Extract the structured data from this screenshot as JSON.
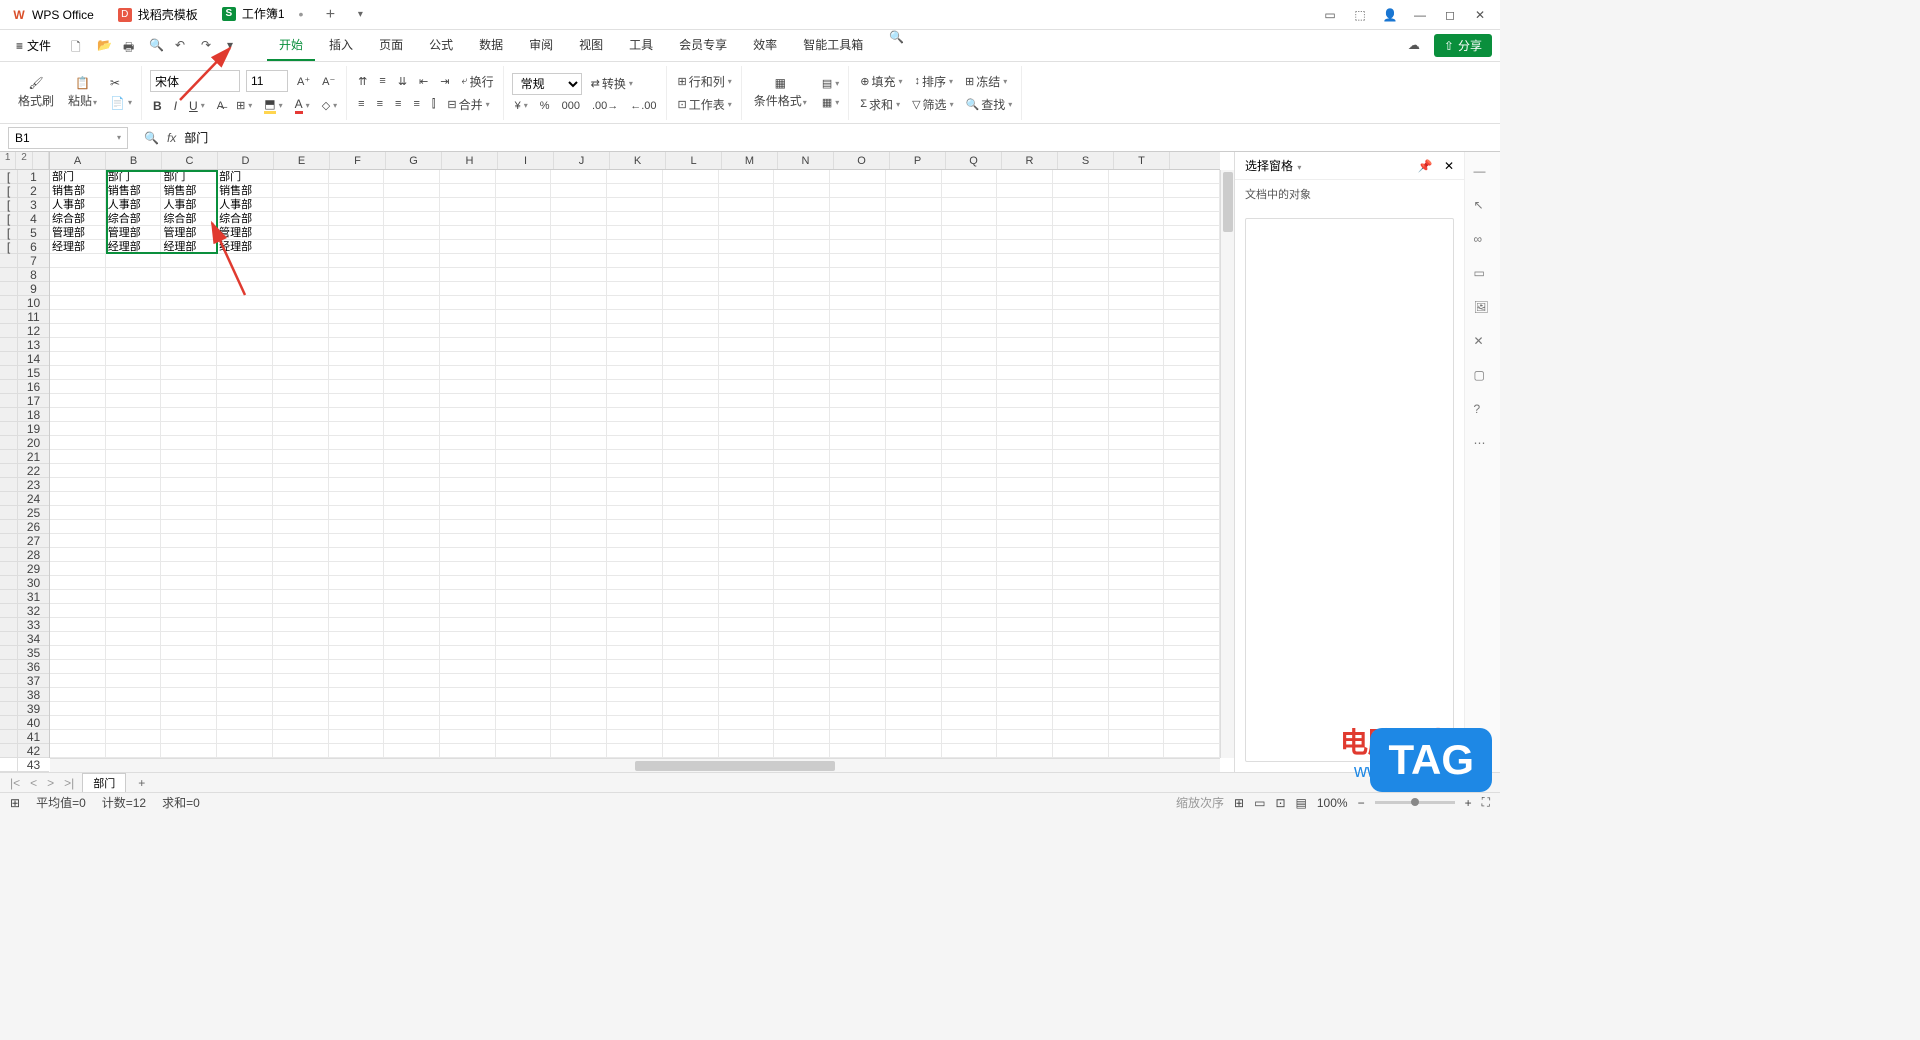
{
  "tabs": {
    "wps": "WPS Office",
    "template": "找稻壳模板",
    "workbook": "工作簿1"
  },
  "menu": {
    "file": "文件",
    "tabs": [
      "开始",
      "插入",
      "页面",
      "公式",
      "数据",
      "审阅",
      "视图",
      "工具",
      "会员专享",
      "效率",
      "智能工具箱"
    ]
  },
  "ribbon": {
    "format_painter": "格式刷",
    "paste": "粘贴",
    "font_name": "宋体",
    "font_size": "11",
    "wrap": "换行",
    "general": "常规",
    "convert": "转换",
    "row_col": "行和列",
    "worksheet": "工作表",
    "cond_format": "条件格式",
    "fill": "填充",
    "sort": "排序",
    "freeze": "冻结",
    "sum": "求和",
    "filter": "筛选",
    "find": "查找",
    "merge": "合并"
  },
  "namebox": "B1",
  "fx_value": "部门",
  "columns": [
    "A",
    "B",
    "C",
    "D",
    "E",
    "F",
    "G",
    "H",
    "I",
    "J",
    "K",
    "L",
    "M",
    "N",
    "O",
    "P",
    "Q",
    "R",
    "S",
    "T"
  ],
  "row_labels": [
    "1",
    "2",
    "3",
    "4",
    "5",
    "6",
    "7",
    "8",
    "9",
    "10",
    "11",
    "12",
    "13",
    "14",
    "15",
    "16",
    "17",
    "18",
    "19",
    "20",
    "21",
    "22",
    "23",
    "24",
    "25",
    "26",
    "27",
    "28",
    "29",
    "30",
    "31",
    "32",
    "33",
    "34",
    "35",
    "36",
    "37",
    "38",
    "39",
    "40",
    "41",
    "42",
    "43"
  ],
  "cells": {
    "r1": [
      "部门",
      "部门",
      "部门",
      "部门"
    ],
    "r2": [
      "销售部",
      "销售部",
      "销售部",
      "销售部"
    ],
    "r3": [
      "人事部",
      "人事部",
      "人事部",
      "人事部"
    ],
    "r4": [
      "综合部",
      "综合部",
      "综合部",
      "综合部"
    ],
    "r5": [
      "管理部",
      "管理部",
      "管理部",
      "管理部"
    ],
    "r6": [
      "经理部",
      "经理部",
      "经理部",
      "经理部"
    ]
  },
  "rightpanel": {
    "title": "选择窗格",
    "subtitle": "文档中的对象"
  },
  "sheet_tab": "部门",
  "status": {
    "avg": "平均值=0",
    "count": "计数=12",
    "sum": "求和=0",
    "zoom_label": "缩放次序",
    "zoom": "100%"
  },
  "share": "分享",
  "watermark": {
    "line1": "电脑技术网",
    "line2": "www.tagxp.com"
  },
  "tag": "TAG"
}
